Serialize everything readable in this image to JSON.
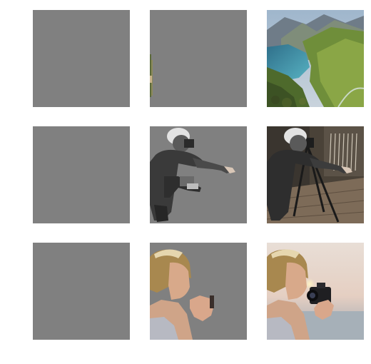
{
  "grid": {
    "rows": 3,
    "cols": 3,
    "placeholder_color": "#808080",
    "tiles": [
      {
        "row": 0,
        "col": 0,
        "content": "gray-placeholder"
      },
      {
        "row": 0,
        "col": 1,
        "content": "gray-placeholder-with-partial-fjord-sliver"
      },
      {
        "row": 0,
        "col": 2,
        "content": "fjord-landscape-photo"
      },
      {
        "row": 1,
        "col": 0,
        "content": "gray-placeholder"
      },
      {
        "row": 1,
        "col": 1,
        "content": "photographer-cutout-on-gray"
      },
      {
        "row": 1,
        "col": 2,
        "content": "photographer-with-tripod-photo"
      },
      {
        "row": 2,
        "col": 0,
        "content": "gray-placeholder"
      },
      {
        "row": 2,
        "col": 1,
        "content": "woman-with-camera-cutout-on-gray"
      },
      {
        "row": 2,
        "col": 2,
        "content": "woman-with-camera-photo"
      }
    ]
  }
}
